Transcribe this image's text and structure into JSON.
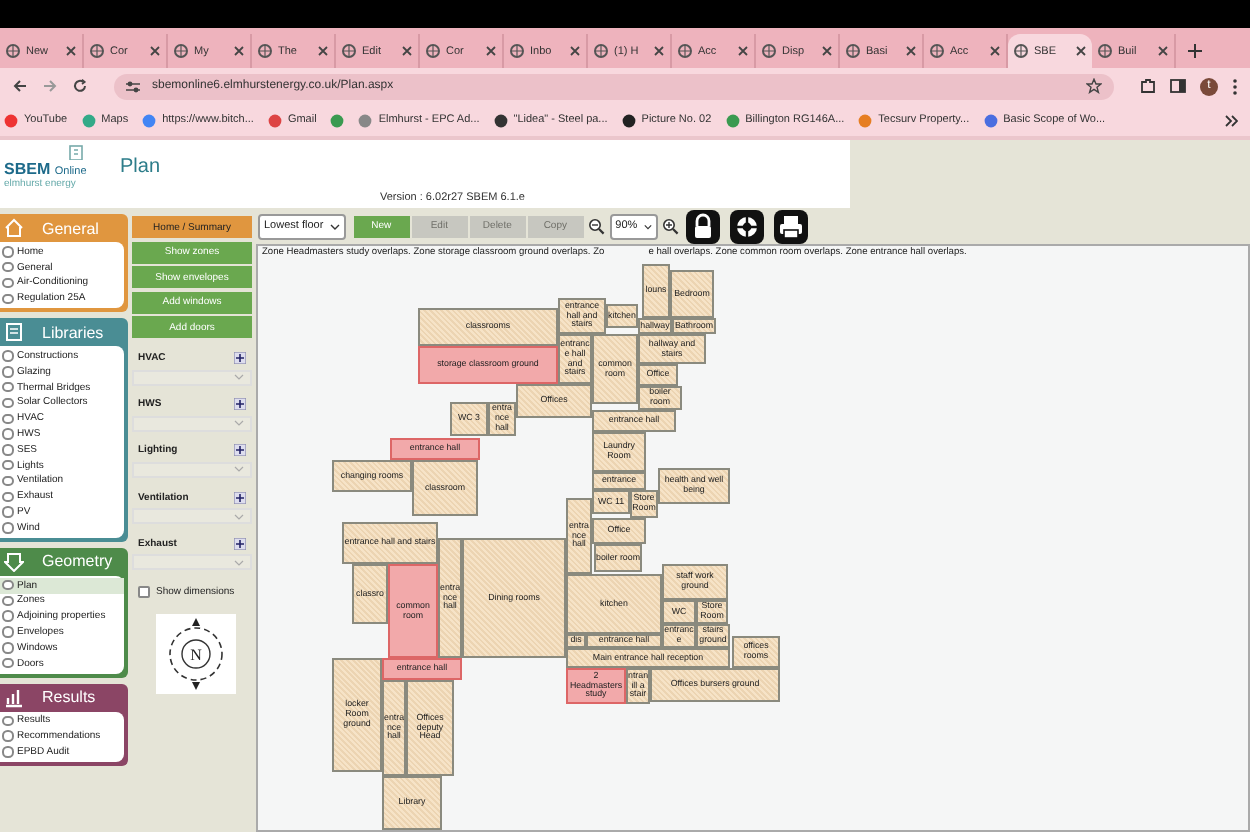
{
  "browser": {
    "tabs": [
      {
        "label": "New",
        "selected": false
      },
      {
        "label": "Cor",
        "selected": false
      },
      {
        "label": "My",
        "selected": false
      },
      {
        "label": "The",
        "selected": false
      },
      {
        "label": "Edit",
        "selected": false
      },
      {
        "label": "Cor",
        "selected": false
      },
      {
        "label": "Inbo",
        "selected": false
      },
      {
        "label": "(1) H",
        "selected": false
      },
      {
        "label": "Acc",
        "selected": false
      },
      {
        "label": "Disp",
        "selected": false
      },
      {
        "label": "Basi",
        "selected": false
      },
      {
        "label": "Acc",
        "selected": false
      },
      {
        "label": "SBE",
        "selected": true
      },
      {
        "label": "Buil",
        "selected": false
      }
    ],
    "address": "sbemonline6.elmhurstenergy.co.uk/Plan.aspx",
    "avatar": "t",
    "bookmarks": [
      {
        "kind": "text",
        "label": "YouTube"
      },
      {
        "kind": "text",
        "label": "Maps"
      },
      {
        "kind": "text",
        "label": "https://www.bitch..."
      },
      {
        "kind": "text",
        "label": "Gmail"
      },
      {
        "kind": "icon"
      },
      {
        "kind": "text",
        "label": "Elmhurst - EPC Ad..."
      },
      {
        "kind": "text",
        "label": "\"Lidea\" - Steel pa..."
      },
      {
        "kind": "text",
        "label": "Picture No. 02"
      },
      {
        "kind": "text",
        "label": "Billington RG146A..."
      },
      {
        "kind": "text",
        "label": "Tecsurv Property..."
      },
      {
        "kind": "text",
        "label": "Basic Scope of Wo..."
      }
    ]
  },
  "header": {
    "logo_title": "SBEM",
    "logo_suffix": "Online",
    "logo_subtitle": "elmhurst energy",
    "page_title": "Plan",
    "version": "Version : 6.02r27 SBEM 6.1.e"
  },
  "sidebar": {
    "sections": [
      {
        "title": "General",
        "kind": "general",
        "color": "#e0963f",
        "items": [
          {
            "label": "Home",
            "selected": false
          },
          {
            "label": "General",
            "selected": false
          },
          {
            "label": "Air-Conditioning",
            "selected": false
          },
          {
            "label": "Regulation 25A",
            "selected": false
          }
        ]
      },
      {
        "title": "Libraries",
        "kind": "libraries",
        "color": "#4a8d94",
        "items": [
          {
            "label": "Constructions",
            "selected": false
          },
          {
            "label": "Glazing",
            "selected": false
          },
          {
            "label": "Thermal Bridges",
            "selected": false
          },
          {
            "label": "Solar Collectors",
            "selected": false
          },
          {
            "label": "HVAC",
            "selected": false
          },
          {
            "label": "HWS",
            "selected": false
          },
          {
            "label": "SES",
            "selected": false
          },
          {
            "label": "Lights",
            "selected": false
          },
          {
            "label": "Ventilation",
            "selected": false
          },
          {
            "label": "Exhaust",
            "selected": false
          },
          {
            "label": "PV",
            "selected": false
          },
          {
            "label": "Wind",
            "selected": false
          }
        ]
      },
      {
        "title": "Geometry",
        "kind": "geometry",
        "color": "#4e8b4a",
        "items": [
          {
            "label": "Plan",
            "selected": true
          },
          {
            "label": "Zones",
            "selected": false
          },
          {
            "label": "Adjoining properties",
            "selected": false
          },
          {
            "label": "Envelopes",
            "selected": false
          },
          {
            "label": "Windows",
            "selected": false
          },
          {
            "label": "Doors",
            "selected": false
          }
        ]
      },
      {
        "title": "Results",
        "kind": "results",
        "color": "#8b4565",
        "items": [
          {
            "label": "Results",
            "selected": false
          },
          {
            "label": "Recommendations",
            "selected": false
          },
          {
            "label": "EPBD Audit",
            "selected": false
          }
        ]
      }
    ]
  },
  "actions": [
    {
      "label": "Home / Summary",
      "kind": "summary"
    },
    {
      "label": "Show zones",
      "kind": "action"
    },
    {
      "label": "Show envelopes",
      "kind": "action"
    },
    {
      "label": "Add windows",
      "kind": "action"
    },
    {
      "label": "Add doors",
      "kind": "action"
    }
  ],
  "services": [
    {
      "label": "HVAC"
    },
    {
      "label": "HWS"
    },
    {
      "label": "Lighting"
    },
    {
      "label": "Ventilation"
    },
    {
      "label": "Exhaust"
    }
  ],
  "show_dimensions": {
    "label": "Show dimensions",
    "checked": false
  },
  "compass": {
    "label": "N"
  },
  "toolbar": {
    "floor": "Lowest floor",
    "zoom": "90%",
    "buttons": [
      {
        "label": "New",
        "disabled": false
      },
      {
        "label": "Edit",
        "disabled": true
      },
      {
        "label": "Delete",
        "disabled": true
      },
      {
        "label": "Copy",
        "disabled": true
      }
    ]
  },
  "plan": {
    "message_parts": [
      "Zone Headmasters study overlaps. Zone storage classroom ground overlaps. Zo",
      "e hall overlaps. Zone common room overlaps. Zone entrance hall overlaps."
    ],
    "rooms": [
      {
        "label": "classrooms",
        "highlighted": false
      },
      {
        "label": "entrance hall and stairs",
        "highlighted": false
      },
      {
        "label": "kitchen",
        "highlighted": false
      },
      {
        "label": "louns",
        "highlighted": false
      },
      {
        "label": "hallway",
        "highlighted": false
      },
      {
        "label": "Bedroom",
        "highlighted": false
      },
      {
        "label": "Bathroom",
        "highlighted": false
      },
      {
        "label": "storage classroom ground",
        "highlighted": true
      },
      {
        "label": "WC 3",
        "highlighted": false
      },
      {
        "label": "entrance hall",
        "highlighted": false
      },
      {
        "label": "Offices",
        "highlighted": false
      },
      {
        "label": "entrance hall and stairs",
        "highlighted": false
      },
      {
        "label": "common room",
        "highlighted": false
      },
      {
        "label": "entrance hall",
        "highlighted": false
      },
      {
        "label": "hallway and stairs",
        "highlighted": false
      },
      {
        "label": "Office",
        "highlighted": false
      },
      {
        "label": "boiler room",
        "highlighted": false
      },
      {
        "label": "entrance hall",
        "highlighted": true
      },
      {
        "label": "changing rooms",
        "highlighted": false
      },
      {
        "label": "classroom",
        "highlighted": false
      },
      {
        "label": "Laundry Room",
        "highlighted": false
      },
      {
        "label": "entrance",
        "highlighted": false
      },
      {
        "label": "entrance hall and stairs",
        "highlighted": false
      },
      {
        "label": "classro",
        "highlighted": false
      },
      {
        "label": "common room",
        "highlighted": true
      },
      {
        "label": "entrance hall",
        "highlighted": false
      },
      {
        "label": "Dining rooms",
        "highlighted": false
      },
      {
        "label": "entrance hall",
        "highlighted": false
      },
      {
        "label": "WC 11",
        "highlighted": false
      },
      {
        "label": "Store Room",
        "highlighted": false
      },
      {
        "label": "health and well being",
        "highlighted": false
      },
      {
        "label": "Office",
        "highlighted": false
      },
      {
        "label": "boiler room",
        "highlighted": false
      },
      {
        "label": "kitchen",
        "highlighted": false
      },
      {
        "label": "staff work ground",
        "highlighted": false
      },
      {
        "label": "WC",
        "highlighted": false
      },
      {
        "label": "Store Room",
        "highlighted": false
      },
      {
        "label": "dis",
        "highlighted": false
      },
      {
        "label": "entrance hall",
        "highlighted": false
      },
      {
        "label": "entrance",
        "highlighted": false
      },
      {
        "label": "stairs ground",
        "highlighted": false
      },
      {
        "label": "locker Room ground",
        "highlighted": false
      },
      {
        "label": "entrance hall",
        "highlighted": true
      },
      {
        "label": "Main entrance hall reception",
        "highlighted": false
      },
      {
        "label": "offices rooms",
        "highlighted": false
      },
      {
        "label": "entrance hall",
        "highlighted": false
      },
      {
        "label": "Offices deputy Head",
        "highlighted": false
      },
      {
        "label": "2 Headmasters study",
        "highlighted": true
      },
      {
        "label": "ntran ill a stair",
        "highlighted": false
      },
      {
        "label": "Offices bursers ground",
        "highlighted": false
      },
      {
        "label": "Library",
        "highlighted": false
      }
    ]
  }
}
